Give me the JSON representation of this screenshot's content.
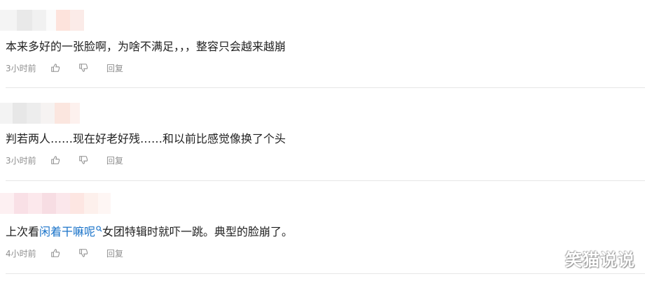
{
  "comments": [
    {
      "text": "本来多好的一张脸啊，为啥不满足，，，整容只会越来越崩",
      "time": "3小时前",
      "reply_label": "回复"
    },
    {
      "text": "判若两人……现在好老好残……和以前比感觉像换了个头",
      "time": "3小时前",
      "reply_label": "回复"
    },
    {
      "text_before": "上次看",
      "link_text": "闲着干嘛呢",
      "text_after": "女团特辑时就吓一跳。典型的脸崩了。",
      "time": "4小时前",
      "reply_label": "回复"
    }
  ],
  "watermark": "笑猫说说",
  "colors": {
    "link": "#1a73c9",
    "meta_text": "#8f8f8f",
    "divider": "#e6e6e6"
  },
  "icons": [
    "thumbs-up-icon",
    "thumbs-down-icon",
    "search-icon"
  ]
}
